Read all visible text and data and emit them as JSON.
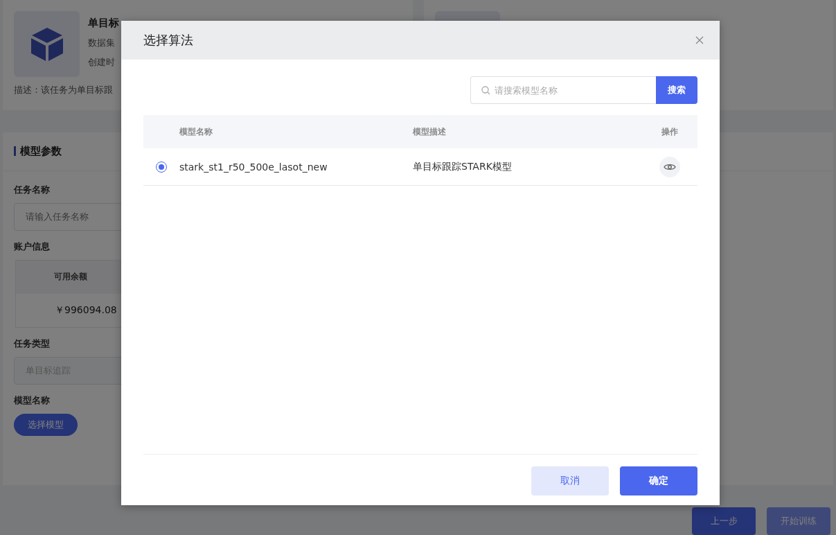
{
  "task_card": {
    "title": "单目标",
    "dataset": "数据集",
    "created": "创建时",
    "description": "描述：该任务为单目标跟"
  },
  "params": {
    "title": "模型参数",
    "task_name": {
      "label": "任务名称",
      "placeholder": "请输入任务名称"
    },
    "account": {
      "label": "账户信息",
      "column": "可用余额",
      "value": "￥996094.08"
    },
    "task_type": {
      "label": "任务类型",
      "value": "单目标追踪"
    },
    "model_name": {
      "label": "模型名称",
      "button": "选择模型"
    }
  },
  "footer_buttons": [
    {
      "label": "上一步",
      "kind": "primary"
    },
    {
      "label": "开始训练",
      "kind": "muted"
    }
  ],
  "dialog": {
    "title": "选择算法",
    "search": {
      "placeholder": "请搜索模型名称",
      "button": "搜索"
    },
    "columns": [
      "模型名称",
      "模型描述",
      "操作"
    ],
    "rows": [
      {
        "name": "stark_st1_r50_500e_lasot_new",
        "description": "单目标跟踪STARK模型",
        "selected": true
      }
    ],
    "buttons": [
      {
        "label": "取消",
        "kind": "secondary"
      },
      {
        "label": "确定",
        "kind": "primary"
      }
    ]
  }
}
